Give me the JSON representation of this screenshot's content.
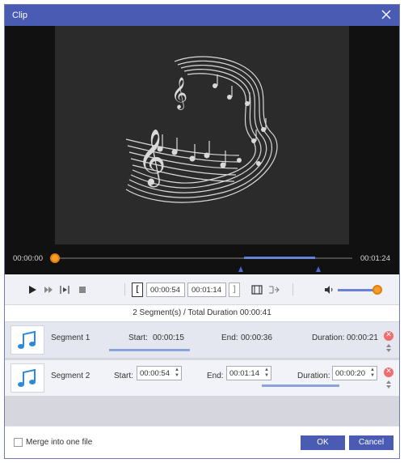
{
  "window": {
    "title": "Clip"
  },
  "preview": {
    "current_time": "00:00:00",
    "total_time": "00:01:24",
    "progress": 0.0
  },
  "controls": {
    "start_value": "00:00:54",
    "end_value": "00:01:14",
    "volume": 0.93
  },
  "summary": "2 Segment(s) / Total Duration 00:00:41",
  "segments": [
    {
      "name": "Segment 1",
      "start_label": "Start:",
      "start": "00:00:15",
      "end_label": "End:",
      "end": "00:00:36",
      "duration_label": "Duration:",
      "duration": "00:00:21"
    },
    {
      "name": "Segment 2",
      "start_label": "Start:",
      "start": "00:00:54",
      "end_label": "End:",
      "end": "00:01:14",
      "duration_label": "Duration:",
      "duration": "00:00:20"
    }
  ],
  "footer": {
    "merge_label": "Merge into one file",
    "merge_checked": false,
    "ok_label": "OK",
    "cancel_label": "Cancel"
  },
  "colors": {
    "accent": "#4a5bb3",
    "knob": "#f59d2a",
    "selection": "#6a7fd6",
    "delete": "#f06d6d",
    "note_icon": "#2e8ad8"
  },
  "icons": [
    "close-icon",
    "play-icon",
    "next-frame-icon",
    "play-selection-icon",
    "stop-icon",
    "split-icon",
    "film-icon",
    "volume-icon",
    "music-note-icon",
    "delete-icon",
    "move-up-icon",
    "move-down-icon"
  ]
}
